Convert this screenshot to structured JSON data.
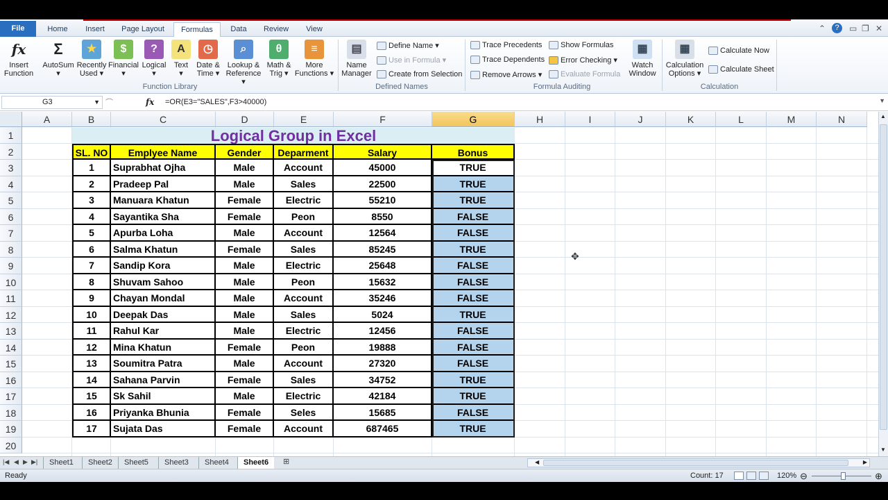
{
  "tabs": [
    "File",
    "Home",
    "Insert",
    "Page Layout",
    "Formulas",
    "Data",
    "Review",
    "View"
  ],
  "active_tab": "Formulas",
  "ribbon": {
    "function_library": {
      "label": "Function Library",
      "buttons": [
        {
          "line1": "Insert",
          "line2": "Function",
          "icon": "fx"
        },
        {
          "line1": "AutoSum",
          "line2": "▾",
          "icon": "Σ"
        },
        {
          "line1": "Recently",
          "line2": "Used ▾",
          "icon": "★"
        },
        {
          "line1": "Financial",
          "line2": "▾",
          "icon": "$"
        },
        {
          "line1": "Logical",
          "line2": "▾",
          "icon": "?"
        },
        {
          "line1": "Text",
          "line2": "▾",
          "icon": "A"
        },
        {
          "line1": "Date &",
          "line2": "Time ▾",
          "icon": "◷"
        },
        {
          "line1": "Lookup &",
          "line2": "Reference ▾",
          "icon": "⌕"
        },
        {
          "line1": "Math &",
          "line2": "Trig ▾",
          "icon": "θ"
        },
        {
          "line1": "More",
          "line2": "Functions ▾",
          "icon": "≡"
        }
      ]
    },
    "defined_names": {
      "label": "Defined Names",
      "name_manager": {
        "line1": "Name",
        "line2": "Manager"
      },
      "define_name": "Define Name ▾",
      "use_in_formula": "Use in Formula ▾",
      "create_from_selection": "Create from Selection"
    },
    "formula_auditing": {
      "label": "Formula Auditing",
      "trace_precedents": "Trace Precedents",
      "trace_dependents": "Trace Dependents",
      "remove_arrows": "Remove Arrows ▾",
      "show_formulas": "Show Formulas",
      "error_checking": "Error Checking ▾",
      "evaluate_formula": "Evaluate Formula",
      "watch_window": {
        "line1": "Watch",
        "line2": "Window"
      }
    },
    "calculation": {
      "label": "Calculation",
      "options": {
        "line1": "Calculation",
        "line2": "Options ▾"
      },
      "calc_now": "Calculate Now",
      "calc_sheet": "Calculate Sheet"
    }
  },
  "formula_bar": {
    "name_box": "G3",
    "fx": "fx",
    "formula": "=OR(E3=\"SALES\",F3>40000)"
  },
  "columns": [
    "A",
    "B",
    "C",
    "D",
    "E",
    "F",
    "G",
    "H",
    "I",
    "J",
    "K",
    "L",
    "M",
    "N"
  ],
  "rows": [
    "1",
    "2",
    "3",
    "4",
    "5",
    "6",
    "7",
    "8",
    "9",
    "10",
    "11",
    "12",
    "13",
    "14",
    "15",
    "16",
    "17",
    "18",
    "19",
    "20"
  ],
  "sheet_title": "Logical Group in Excel",
  "headers": [
    "SL. NO",
    "Emplyee Name",
    "Gender",
    "Deparment",
    "Salary",
    "Bonus"
  ],
  "table": [
    [
      "1",
      "Suprabhat Ojha",
      "Male",
      "Account",
      "45000",
      "TRUE"
    ],
    [
      "2",
      "Pradeep Pal",
      "Male",
      "Sales",
      "22500",
      "TRUE"
    ],
    [
      "3",
      "Manuara Khatun",
      "Female",
      "Electric",
      "55210",
      "TRUE"
    ],
    [
      "4",
      "Sayantika Sha",
      "Female",
      "Peon",
      "8550",
      "FALSE"
    ],
    [
      "5",
      "Apurba Loha",
      "Male",
      "Account",
      "12564",
      "FALSE"
    ],
    [
      "6",
      "Salma Khatun",
      "Female",
      "Sales",
      "85245",
      "TRUE"
    ],
    [
      "7",
      "Sandip Kora",
      "Male",
      "Electric",
      "25648",
      "FALSE"
    ],
    [
      "8",
      "Shuvam Sahoo",
      "Male",
      "Peon",
      "15632",
      "FALSE"
    ],
    [
      "9",
      "Chayan Mondal",
      "Male",
      "Account",
      "35246",
      "FALSE"
    ],
    [
      "10",
      "Deepak Das",
      "Male",
      "Sales",
      "5024",
      "TRUE"
    ],
    [
      "11",
      "Rahul Kar",
      "Male",
      "Electric",
      "12456",
      "FALSE"
    ],
    [
      "12",
      "Mina Khatun",
      "Female",
      "Peon",
      "19888",
      "FALSE"
    ],
    [
      "13",
      "Soumitra Patra",
      "Male",
      "Account",
      "27320",
      "FALSE"
    ],
    [
      "14",
      "Sahana Parvin",
      "Female",
      "Sales",
      "34752",
      "TRUE"
    ],
    [
      "15",
      "Sk Sahil",
      "Male",
      "Electric",
      "42184",
      "TRUE"
    ],
    [
      "16",
      "Priyanka Bhunia",
      "Female",
      "Seles",
      "15685",
      "FALSE"
    ],
    [
      "17",
      "Sujata Das",
      "Female",
      "Account",
      "687465",
      "TRUE"
    ]
  ],
  "sheet_tabs": [
    "Sheet1",
    "Sheet2",
    "Sheet5",
    "Sheet3",
    "Sheet4",
    "Sheet6"
  ],
  "active_sheet": "Sheet6",
  "status": {
    "ready": "Ready",
    "count": "Count: 17",
    "zoom": "120%"
  },
  "colors": {
    "title": "#7030a0",
    "header_fill": "#ffff00",
    "title_fill": "#daeef3",
    "selection": "#b4d3ec",
    "file_tab": "#2a6fbf"
  }
}
